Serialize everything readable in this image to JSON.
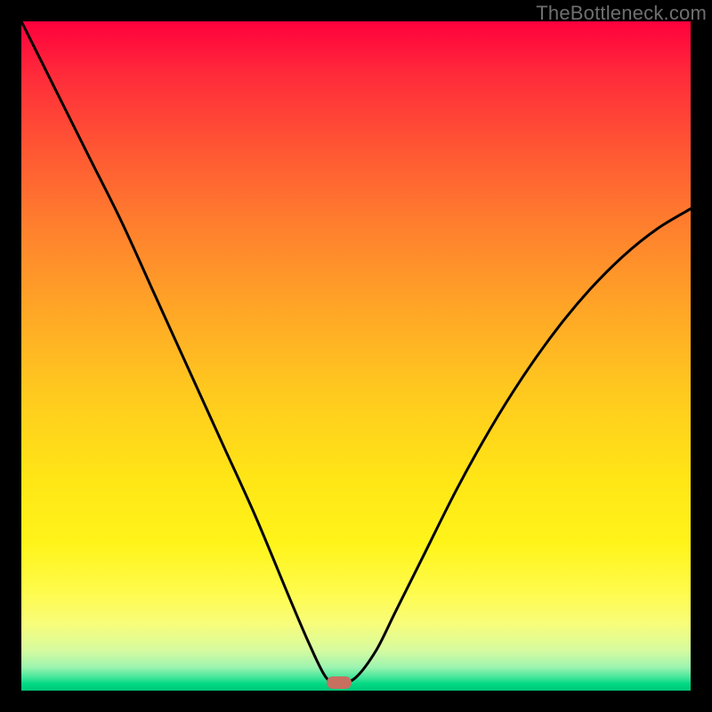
{
  "watermark": "TheBottleneck.com",
  "marker": {
    "cx_frac": 0.475,
    "cy_frac": 0.988
  },
  "chart_data": {
    "type": "line",
    "title": "",
    "xlabel": "",
    "ylabel": "",
    "xlim": [
      0,
      1
    ],
    "ylim": [
      0,
      1
    ],
    "grid": false,
    "legend": false,
    "annotations": [
      "TheBottleneck.com"
    ],
    "series": [
      {
        "name": "bottleneck-curve",
        "x": [
          0.0,
          0.05,
          0.1,
          0.15,
          0.2,
          0.25,
          0.3,
          0.35,
          0.4,
          0.43,
          0.455,
          0.475,
          0.5,
          0.53,
          0.56,
          0.6,
          0.65,
          0.7,
          0.75,
          0.8,
          0.85,
          0.9,
          0.95,
          1.0
        ],
        "y": [
          1.0,
          0.9,
          0.8,
          0.7,
          0.59,
          0.48,
          0.37,
          0.26,
          0.14,
          0.07,
          0.02,
          0.01,
          0.02,
          0.06,
          0.12,
          0.2,
          0.3,
          0.39,
          0.47,
          0.54,
          0.6,
          0.65,
          0.69,
          0.72
        ]
      }
    ],
    "background_gradient": {
      "top": "#ff003d",
      "mid": "#ffe516",
      "bottom": "#00c877"
    },
    "marker": {
      "x": 0.475,
      "y": 0.012,
      "color": "#c77060"
    }
  }
}
